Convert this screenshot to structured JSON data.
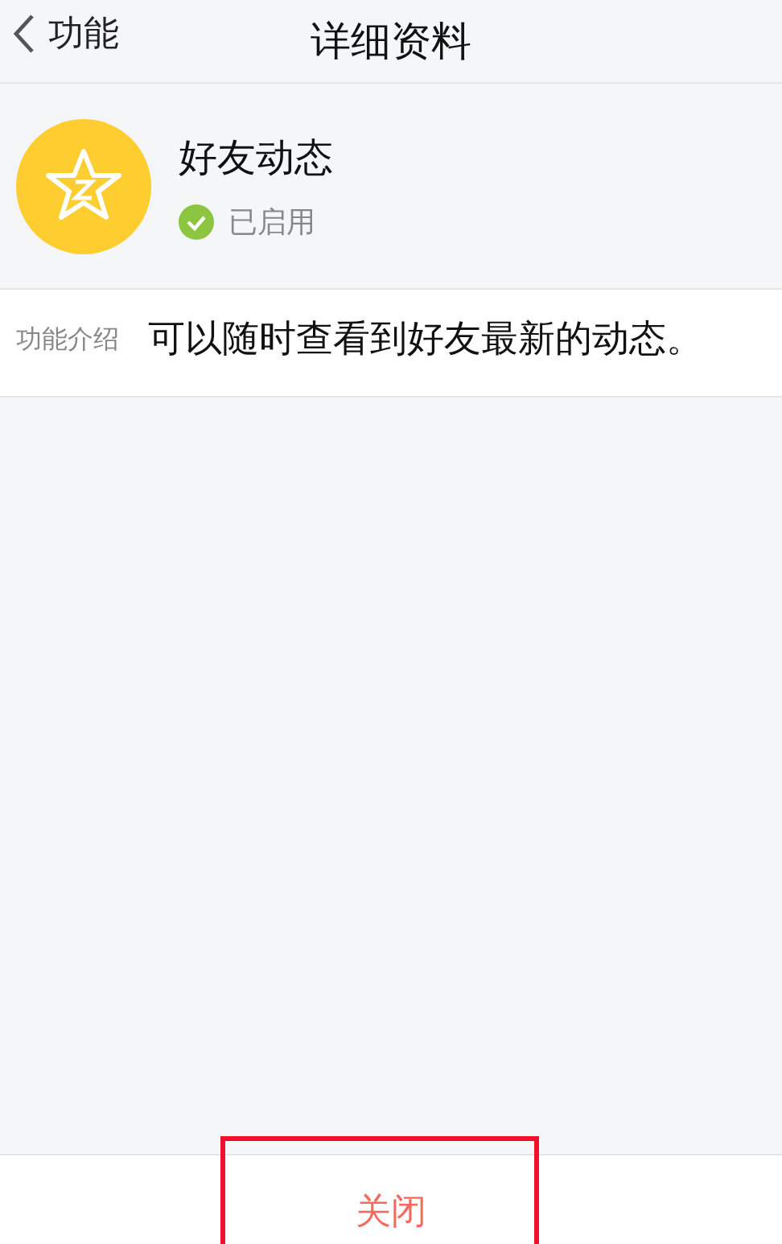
{
  "nav": {
    "back_label": "功能",
    "title": "详细资料"
  },
  "feature": {
    "name": "好友动态",
    "enabled": true,
    "status": "已启用"
  },
  "intro": {
    "label": "功能介绍",
    "text": "可以随时查看到好友最新的动态。"
  },
  "action": {
    "label": "关闭",
    "highlighted": true
  }
}
